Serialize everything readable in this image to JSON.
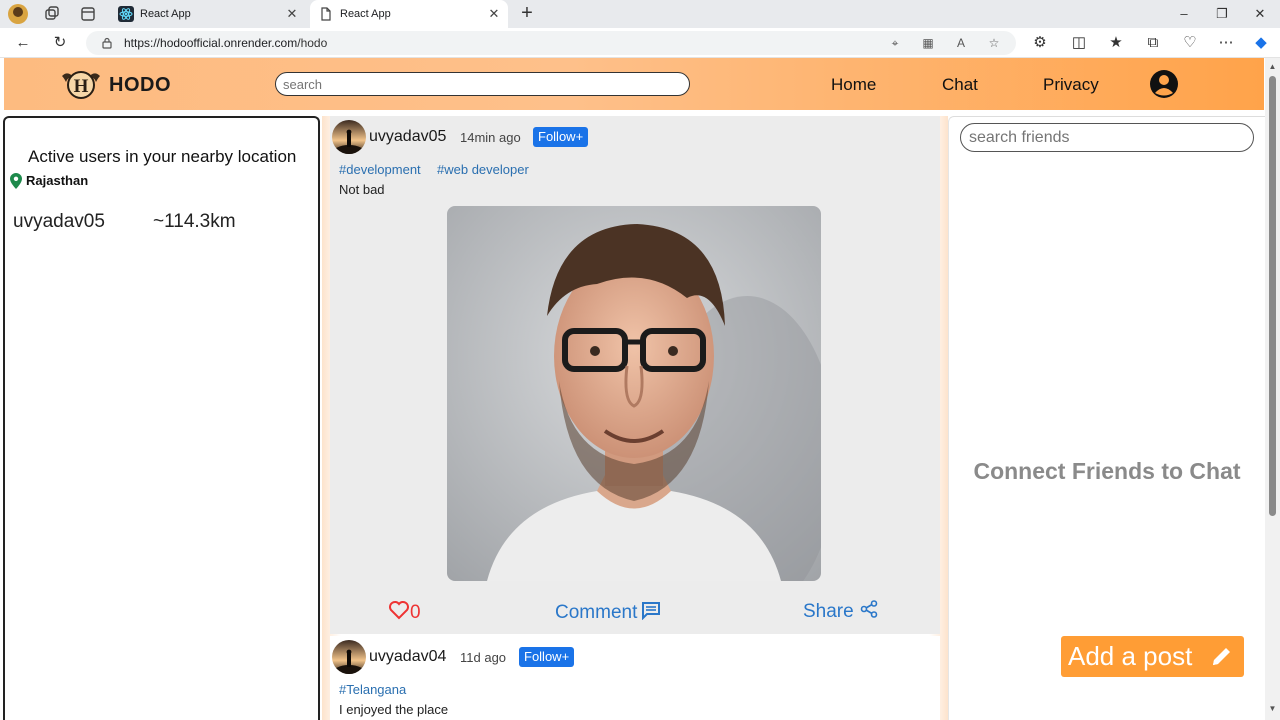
{
  "browser": {
    "tabs": [
      {
        "title": "React App"
      },
      {
        "title": "React App"
      }
    ],
    "url_host": "https://hodoofficial.onrender.com",
    "url_path": "/hodo"
  },
  "header": {
    "brand": "HODO",
    "search_placeholder": "search",
    "nav": {
      "home": "Home",
      "chat": "Chat",
      "privacy": "Privacy"
    }
  },
  "left": {
    "title": "Active users in your nearby location",
    "location": "Rajasthan",
    "users": [
      {
        "name": "uvyadav05",
        "distance": "~114.3km"
      }
    ]
  },
  "posts": [
    {
      "user": "uvyadav05",
      "time": "14min ago",
      "follow": "Follow+",
      "tags": [
        "#development",
        "#web developer"
      ],
      "text": "Not bad",
      "likes": "0",
      "comment_label": "Comment",
      "share_label": "Share"
    },
    {
      "user": "uvyadav04",
      "time": "11d ago",
      "follow": "Follow+",
      "tags": [
        "#Telangana"
      ],
      "text": "I enjoyed the place"
    }
  ],
  "right": {
    "search_placeholder": "search friends",
    "empty_text": "Connect Friends to Chat"
  },
  "add_post_label": "Add a post",
  "colors": {
    "accent": "#ff9d35",
    "link": "#2a6fb0",
    "follow": "#1a73e8",
    "like": "#e33333"
  }
}
